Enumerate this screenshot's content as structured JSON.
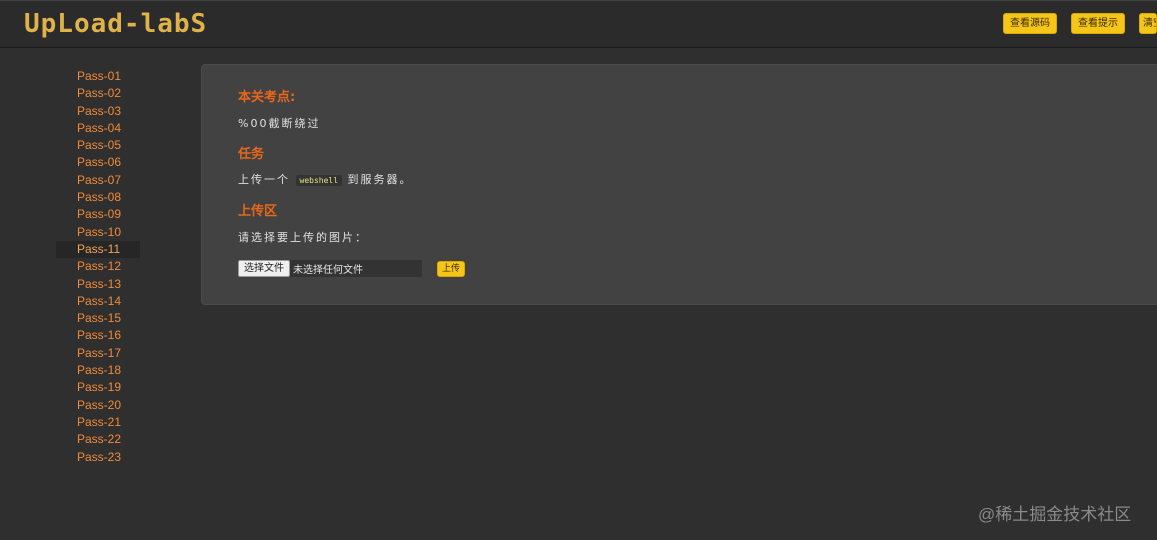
{
  "header": {
    "logo": "UpLoad-labS",
    "buttons": [
      "查看源码",
      "查看提示",
      "清空上传文件"
    ]
  },
  "sidebar": {
    "items": [
      "Pass-01",
      "Pass-02",
      "Pass-03",
      "Pass-04",
      "Pass-05",
      "Pass-06",
      "Pass-07",
      "Pass-08",
      "Pass-09",
      "Pass-10",
      "Pass-11",
      "Pass-12",
      "Pass-13",
      "Pass-14",
      "Pass-15",
      "Pass-16",
      "Pass-17",
      "Pass-18",
      "Pass-19",
      "Pass-20",
      "Pass-21",
      "Pass-22",
      "Pass-23"
    ],
    "active": "Pass-11"
  },
  "main": {
    "focus_title": "本关考点:",
    "focus_text": "%00截断绕过",
    "task_title": "任务",
    "task_prefix": "上传一个",
    "task_code": "webshell",
    "task_suffix": "到服务器。",
    "upload_title": "上传区",
    "upload_prompt": "请选择要上传的图片：",
    "file_button": "选择文件",
    "file_status": "未选择任何文件",
    "upload_button": "上传"
  },
  "watermark": "@稀土掘金技术社区",
  "colors": {
    "accent": "#f5c518",
    "link": "#f08a3a",
    "title": "#e8671a",
    "background": "#2f2f2f",
    "panel": "#424242"
  }
}
